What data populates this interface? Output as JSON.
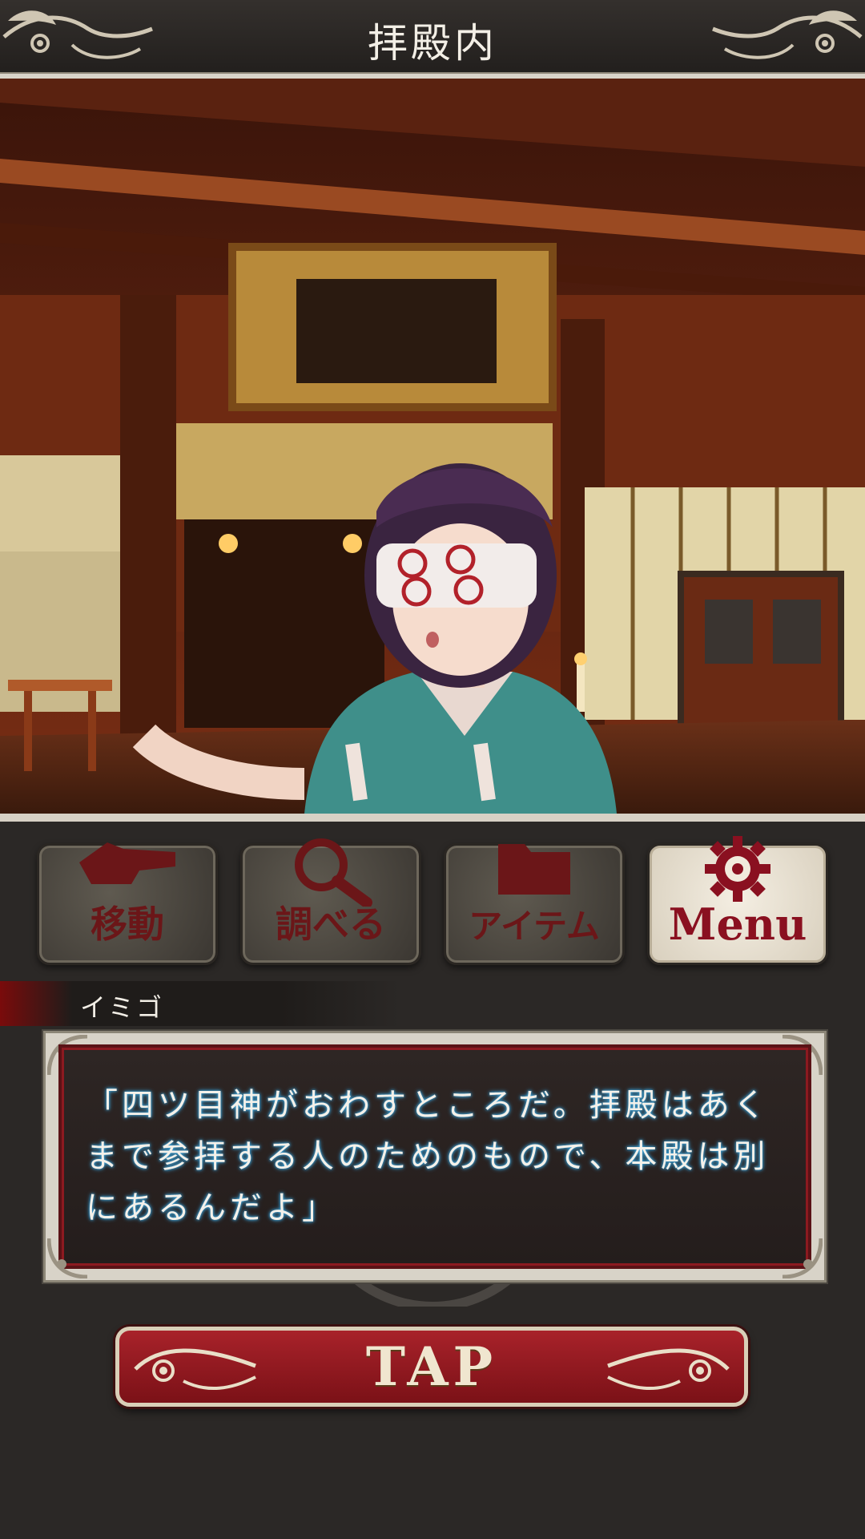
{
  "header": {
    "title": "拝殿内"
  },
  "commands": [
    {
      "label": "移動",
      "icon": "hand-pointing-icon"
    },
    {
      "label": "調べる",
      "icon": "magnifier-icon"
    },
    {
      "label": "アイテム",
      "icon": "folder-icon"
    },
    {
      "label": "Menu",
      "icon": "gear-icon"
    }
  ],
  "dialog": {
    "speaker": "イミゴ",
    "text": "「四ツ目神がおわすところだ。拝殿はあくまで参拝する人のためのもので、本殿は別にあるんだよ」"
  },
  "tap": {
    "label": "TAP"
  },
  "colors": {
    "accent_red": "#8a1020",
    "frame": "#d8d3c8",
    "text_glow": "#3aa7e0"
  }
}
